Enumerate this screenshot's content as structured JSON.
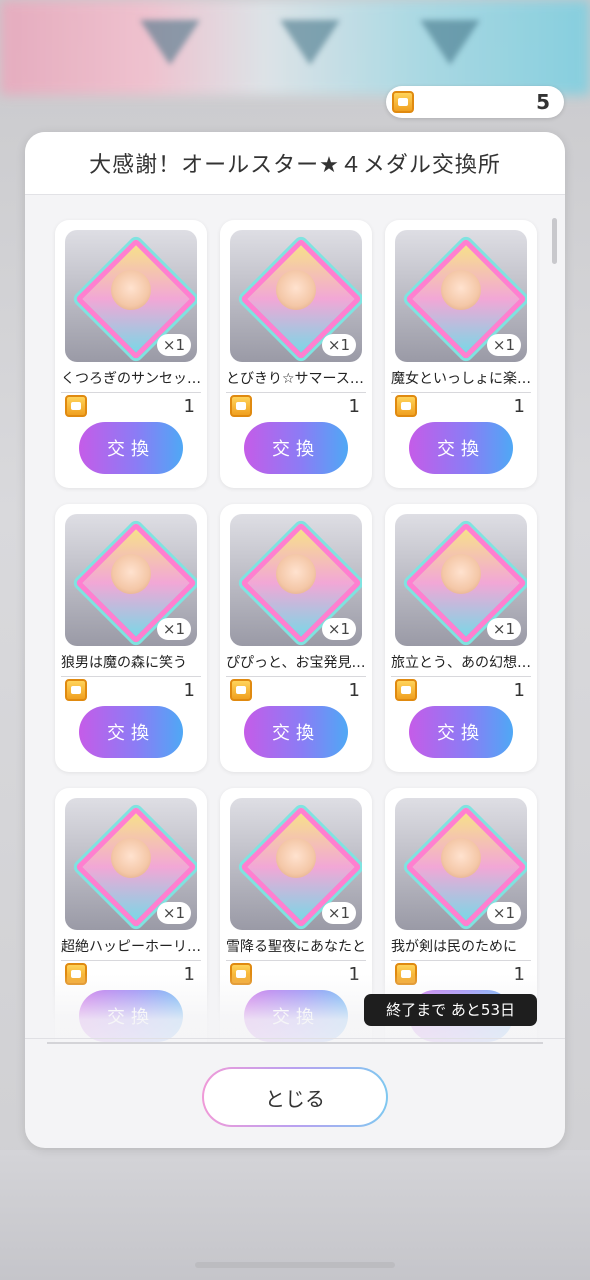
{
  "header": {
    "medal_count": "5",
    "medal_icon": "medal-ticket-icon"
  },
  "panel": {
    "title": "大感謝！オールスター★４メダル交換所"
  },
  "items": [
    {
      "name": "くつろぎのサンセットブ…",
      "quantity": "×1",
      "cost": "1",
      "button": "交換",
      "colors": [
        "#ff7fd0",
        "#7fe3e0"
      ]
    },
    {
      "name": "とびきり☆サマースプラ…",
      "quantity": "×1",
      "cost": "1",
      "button": "交換",
      "colors": [
        "#ff7fd0",
        "#7fe3e0"
      ]
    },
    {
      "name": "魔女といっしょに楽しも…",
      "quantity": "×1",
      "cost": "1",
      "button": "交換",
      "colors": [
        "#ff7fd0",
        "#7fe3e0"
      ]
    },
    {
      "name": "狼男は魔の森に笑う",
      "quantity": "×1",
      "cost": "1",
      "button": "交換",
      "colors": [
        "#ff7fd0",
        "#7fe3e0"
      ]
    },
    {
      "name": "ぴぴっと、お宝発見です…",
      "quantity": "×1",
      "cost": "1",
      "button": "交換",
      "colors": [
        "#ff7fd0",
        "#7fe3e0"
      ]
    },
    {
      "name": "旅立とう、あの幻想の大…",
      "quantity": "×1",
      "cost": "1",
      "button": "交換",
      "colors": [
        "#ff7fd0",
        "#7fe3e0"
      ]
    },
    {
      "name": "超絶ハッピーホーリーナ…",
      "quantity": "×1",
      "cost": "1",
      "button": "交換",
      "colors": [
        "#ff7fd0",
        "#7fe3e0"
      ]
    },
    {
      "name": "雪降る聖夜にあなたと",
      "quantity": "×1",
      "cost": "1",
      "button": "交換",
      "colors": [
        "#ff7fd0",
        "#7fe3e0"
      ]
    },
    {
      "name": "我が剣は民のために",
      "quantity": "×1",
      "cost": "1",
      "button": "交換",
      "colors": [
        "#ff7fd0",
        "#7fe3e0"
      ]
    }
  ],
  "footer": {
    "deadline": "終了まで あと53日",
    "close_label": "とじる"
  }
}
